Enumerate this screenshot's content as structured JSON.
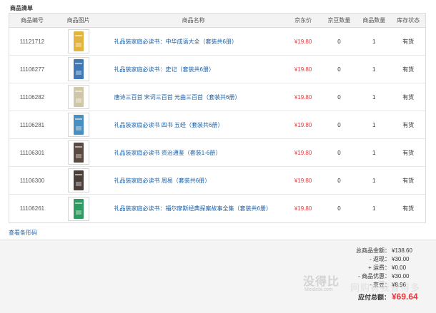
{
  "section_title": "商品清单",
  "headers": {
    "id": "商品编号",
    "image": "商品图片",
    "name": "商品名称",
    "price": "京东价",
    "beans": "京豆数量",
    "qty": "商品数量",
    "stock": "库存状态"
  },
  "rows": [
    {
      "id": "11121712",
      "name": "礼品装家庭必读书：中华成语大全（套装共6册）",
      "price": "¥19.80",
      "beans": "0",
      "qty": "1",
      "stock": "有货",
      "cover_color": "#e4b33c"
    },
    {
      "id": "11106277",
      "name": "礼品装家庭必读书：史记（套装共6册）",
      "price": "¥19.80",
      "beans": "0",
      "qty": "1",
      "stock": "有货",
      "cover_color": "#3f78b5"
    },
    {
      "id": "11106282",
      "name": "唐诗三百首 宋词三百首 元曲三百首（套装共6册）",
      "price": "¥19.80",
      "beans": "0",
      "qty": "1",
      "stock": "有货",
      "cover_color": "#cfc7a8"
    },
    {
      "id": "11106281",
      "name": "礼品装家庭必读书 四书 五经（套装共6册）",
      "price": "¥19.80",
      "beans": "0",
      "qty": "1",
      "stock": "有货",
      "cover_color": "#4a8fc0"
    },
    {
      "id": "11106301",
      "name": "礼品装家庭必读书 资治通鉴（套装1-6册）",
      "price": "¥19.80",
      "beans": "0",
      "qty": "1",
      "stock": "有货",
      "cover_color": "#5a4a42"
    },
    {
      "id": "11106300",
      "name": "礼品装家庭必读书 周易（套装共6册）",
      "price": "¥19.80",
      "beans": "0",
      "qty": "1",
      "stock": "有货",
      "cover_color": "#4b3f3a"
    },
    {
      "id": "11106261",
      "name": "礼品装家庭必读书：福尔摩斯经典探案故事全集（套装共6册）",
      "price": "¥19.80",
      "beans": "0",
      "qty": "1",
      "stock": "有货",
      "cover_color": "#2f9a62"
    }
  ],
  "view_code_link": "查看条形码",
  "summary": {
    "total_label": "总商品金额：",
    "total_value": "¥138.60",
    "rebate_label": "- 返现：",
    "rebate_value": "¥30.00",
    "shipping_label": "+ 运费：",
    "shipping_value": "¥0.00",
    "discount_label": "- 商品优惠：",
    "discount_value": "¥30.00",
    "beans_label": "- 京豆：",
    "beans_value": "¥8.96",
    "pay_label": "应付总额：",
    "pay_value": "¥69.64"
  },
  "watermark": {
    "main": "没得比",
    "sub": "Meidebi.com",
    "side": "网购有我省得多"
  }
}
